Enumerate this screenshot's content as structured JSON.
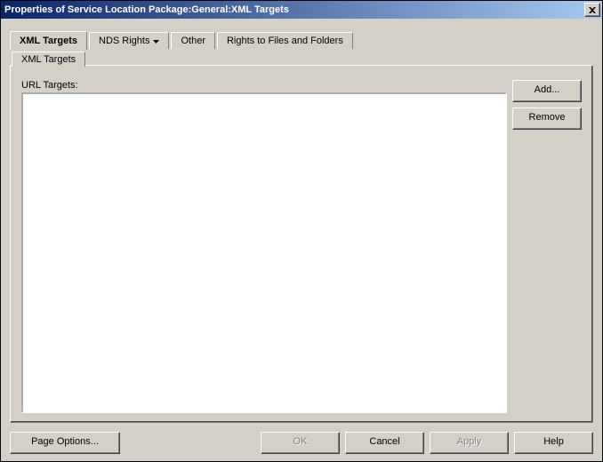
{
  "titlebar": {
    "title": "Properties of Service Location Package:General:XML Targets"
  },
  "tabs": {
    "xml_targets": "XML Targets",
    "nds_rights": "NDS Rights",
    "other": "Other",
    "rights": "Rights to Files and Folders"
  },
  "subtabs": {
    "xml_targets": "XML Targets"
  },
  "panel": {
    "url_targets_label": "URL Targets:"
  },
  "side_buttons": {
    "add": "Add...",
    "remove": "Remove"
  },
  "footer": {
    "page_options": "Page Options...",
    "ok": "OK",
    "cancel": "Cancel",
    "apply": "Apply",
    "help": "Help"
  }
}
